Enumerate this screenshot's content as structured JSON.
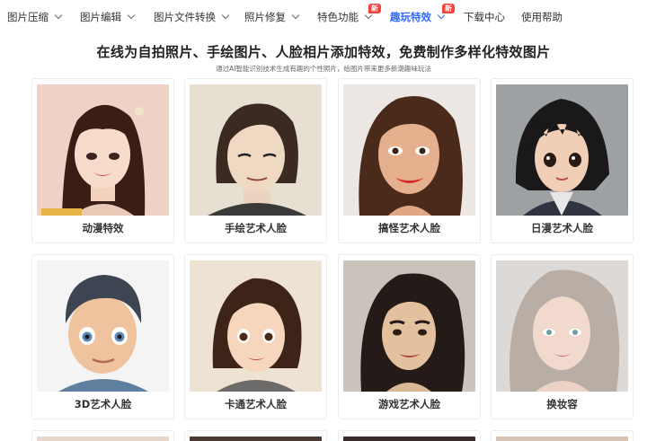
{
  "nav": {
    "items": [
      {
        "label": "图片压缩",
        "dropdown": true
      },
      {
        "label": "图片编辑",
        "dropdown": true
      },
      {
        "label": "图片文件转换",
        "dropdown": true
      },
      {
        "label": "照片修复",
        "dropdown": true
      },
      {
        "label": "特色功能",
        "dropdown": true,
        "badge": "新"
      },
      {
        "label": "趣玩特效",
        "dropdown": true,
        "badge": "新",
        "active": true
      },
      {
        "label": "下载中心",
        "dropdown": false
      },
      {
        "label": "使用帮助",
        "dropdown": false
      }
    ],
    "accent_color": "#2f6bff",
    "badge_color": "#f2453d"
  },
  "header": {
    "title": "在线为自拍照片、手绘图片、人脸相片添加特效，免费制作多样化特效图片",
    "subtitle": "通过AI智能识别技术生成有趣的个性照片，给图片带来更多新潮趣味玩法"
  },
  "effects": [
    {
      "label": "动漫特效"
    },
    {
      "label": "手绘艺术人脸"
    },
    {
      "label": "搞怪艺术人脸"
    },
    {
      "label": "日漫艺术人脸"
    },
    {
      "label": "3D艺术人脸"
    },
    {
      "label": "卡通艺术人脸"
    },
    {
      "label": "游戏艺术人脸"
    },
    {
      "label": "换妆容"
    }
  ]
}
